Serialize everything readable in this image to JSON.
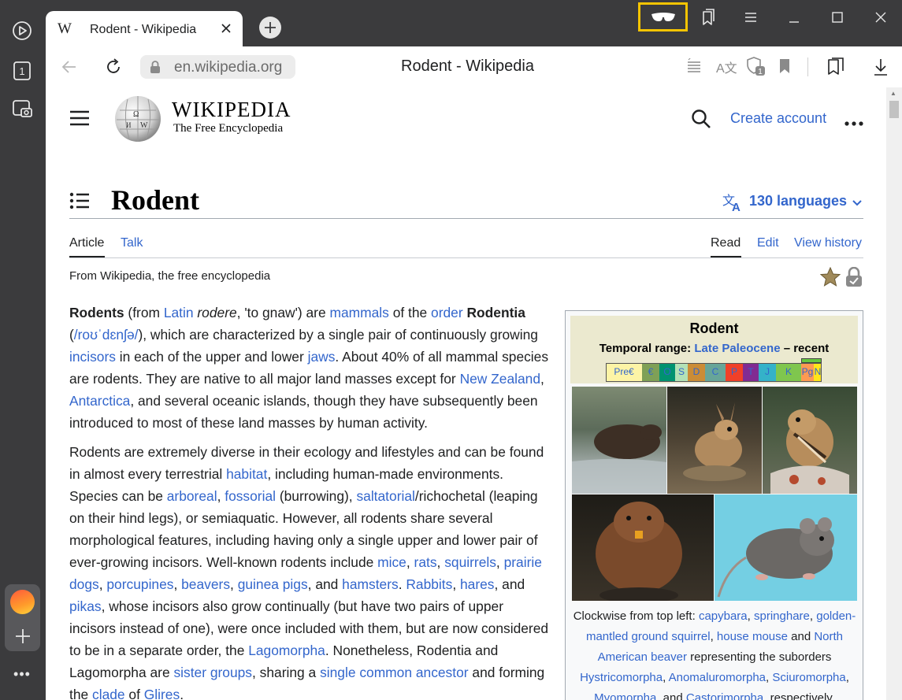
{
  "browser": {
    "tab": {
      "favicon_letter": "W",
      "title": "Rodent - Wikipedia"
    },
    "url": "en.wikipedia.org",
    "page_title": "Rodent - Wikipedia",
    "sidebar_badge": "1",
    "sidebar_more": "•••",
    "reader_highlight_color": "#f5c400"
  },
  "wiki": {
    "logo_title": "WIKIPEDIA",
    "logo_tagline": "The Free Encyclopedia",
    "create_account": "Create account",
    "heading": "Rodent",
    "languages": "130 languages",
    "tabs": {
      "article": "Article",
      "talk": "Talk",
      "read": "Read",
      "edit": "Edit",
      "history": "View history"
    },
    "from": "From Wikipedia, the free encyclopedia",
    "paragraph1": [
      {
        "t": "Rodents",
        "b": true
      },
      {
        "t": " (from "
      },
      {
        "t": "Latin",
        "a": true
      },
      {
        "t": " "
      },
      {
        "t": "rodere",
        "i": true
      },
      {
        "t": ", 'to gnaw') are "
      },
      {
        "t": "mammals",
        "a": true
      },
      {
        "t": " of the "
      },
      {
        "t": "order",
        "a": true
      },
      {
        "t": " "
      },
      {
        "t": "Rodentia",
        "b": true
      },
      {
        "t": " ("
      },
      {
        "t": "/roʊˈdɛnʃə/",
        "a": true
      },
      {
        "t": "), which are characterized by a single pair of continuously growing "
      },
      {
        "t": "incisors",
        "a": true
      },
      {
        "t": " in each of the upper and lower "
      },
      {
        "t": "jaws",
        "a": true
      },
      {
        "t": ". About 40% of all mammal species are rodents. They are native to all major land masses except for "
      },
      {
        "t": "New Zealand",
        "a": true
      },
      {
        "t": ", "
      },
      {
        "t": "Antarctica",
        "a": true
      },
      {
        "t": ", and several oceanic islands, though they have subsequently been introduced to most of these land masses by human activity."
      }
    ],
    "paragraph2": [
      {
        "t": "Rodents are extremely diverse in their ecology and lifestyles and can be found in almost every terrestrial "
      },
      {
        "t": "habitat",
        "a": true
      },
      {
        "t": ", including human-made environments. Species can be "
      },
      {
        "t": "arboreal",
        "a": true
      },
      {
        "t": ", "
      },
      {
        "t": "fossorial",
        "a": true
      },
      {
        "t": " (burrowing), "
      },
      {
        "t": "saltatorial",
        "a": true
      },
      {
        "t": "/richochetal (leaping on their hind legs), or semiaquatic. However, all rodents share several morphological features, including having only a single upper and lower pair of ever-growing incisors. Well-known rodents include "
      },
      {
        "t": "mice",
        "a": true
      },
      {
        "t": ", "
      },
      {
        "t": "rats",
        "a": true
      },
      {
        "t": ", "
      },
      {
        "t": "squirrels",
        "a": true
      },
      {
        "t": ", "
      },
      {
        "t": "prairie dogs",
        "a": true
      },
      {
        "t": ", "
      },
      {
        "t": "porcupines",
        "a": true
      },
      {
        "t": ", "
      },
      {
        "t": "beavers",
        "a": true
      },
      {
        "t": ", "
      },
      {
        "t": "guinea pigs",
        "a": true
      },
      {
        "t": ", and "
      },
      {
        "t": "hamsters",
        "a": true
      },
      {
        "t": ". "
      },
      {
        "t": "Rabbits",
        "a": true
      },
      {
        "t": ", "
      },
      {
        "t": "hares",
        "a": true
      },
      {
        "t": ", and "
      },
      {
        "t": "pikas",
        "a": true
      },
      {
        "t": ", whose incisors also grow continually (but have two pairs of upper incisors instead of one), were once included with them, but are now considered to be in a separate order, the "
      },
      {
        "t": "Lagomorpha",
        "a": true
      },
      {
        "t": ". Nonetheless, Rodentia and Lagomorpha are "
      },
      {
        "t": "sister groups",
        "a": true
      },
      {
        "t": ", sharing a "
      },
      {
        "t": "single common ancestor",
        "a": true
      },
      {
        "t": " and forming the "
      },
      {
        "t": "clade",
        "a": true
      },
      {
        "t": " of "
      },
      {
        "t": "Glires",
        "a": true
      },
      {
        "t": "."
      }
    ],
    "infobox": {
      "title": "Rodent",
      "range_label": "Temporal range: ",
      "range_link": "Late Paleocene",
      "range_suffix": " – recent",
      "periods": [
        {
          "label": "Pre€",
          "color": "#fdf4a6",
          "w": 46
        },
        {
          "label": "€",
          "color": "#7fa056",
          "w": 22
        },
        {
          "label": "O",
          "color": "#009270",
          "w": 20
        },
        {
          "label": "S",
          "color": "#b3e1b6",
          "w": 16
        },
        {
          "label": "D",
          "color": "#cb8c37",
          "w": 22
        },
        {
          "label": "C",
          "color": "#67a599",
          "w": 26
        },
        {
          "label": "P",
          "color": "#f04028",
          "w": 22
        },
        {
          "label": "T",
          "color": "#812b92",
          "w": 20
        },
        {
          "label": "J",
          "color": "#34b2c9",
          "w": 22
        },
        {
          "label": "K",
          "color": "#7fc64e",
          "w": 32
        },
        {
          "label": "Pg",
          "color": "#fd9a52",
          "w": 16
        },
        {
          "label": "N",
          "color": "#ffe619",
          "w": 10
        }
      ],
      "caption": [
        {
          "t": "Clockwise from top left: "
        },
        {
          "t": "capybara",
          "a": true
        },
        {
          "t": ", "
        },
        {
          "t": "springhare",
          "a": true
        },
        {
          "t": ", "
        },
        {
          "t": "golden-mantled ground squirrel",
          "a": true
        },
        {
          "t": ", "
        },
        {
          "t": "house mouse",
          "a": true
        },
        {
          "t": " and "
        },
        {
          "t": "North American beaver",
          "a": true
        },
        {
          "t": " representing the suborders "
        },
        {
          "t": "Hystricomorpha",
          "a": true
        },
        {
          "t": ", "
        },
        {
          "t": "Anomaluromorpha",
          "a": true
        },
        {
          "t": ", "
        },
        {
          "t": "Sciuromorpha",
          "a": true
        },
        {
          "t": ", "
        },
        {
          "t": "Myomorpha",
          "a": true
        },
        {
          "t": ", and "
        },
        {
          "t": "Castorimorpha",
          "a": true
        },
        {
          "t": ", respectively."
        }
      ]
    }
  }
}
